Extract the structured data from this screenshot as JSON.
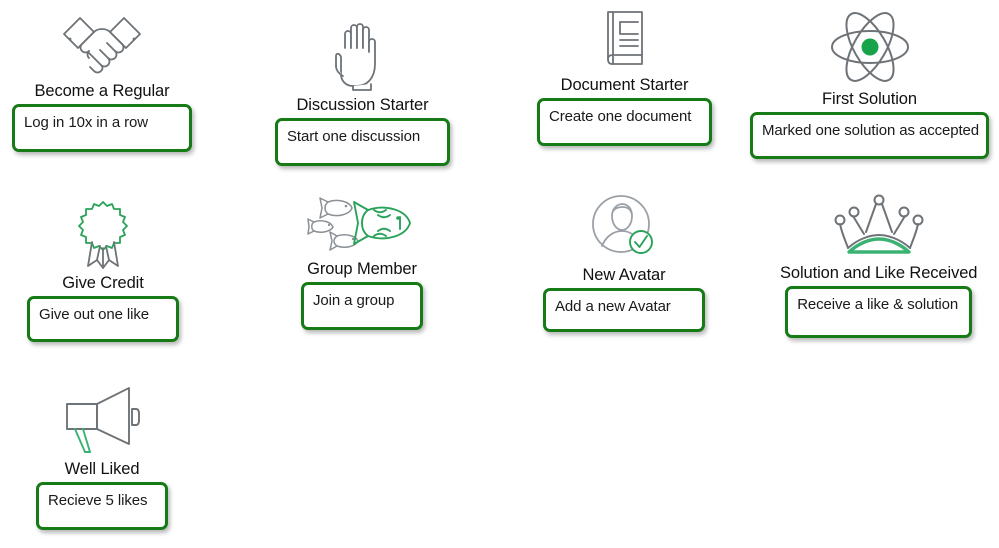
{
  "page": {
    "background": "#ffffff",
    "accent_green": "#167A16",
    "icon_stroke": "#6e7378",
    "icon_accent_green": "#21a05a"
  },
  "badges": [
    {
      "icon": "handshake-icon",
      "title": "Become a Regular",
      "description": "Log in 10x in a row"
    },
    {
      "icon": "raised-hand-icon",
      "title": "Discussion Starter",
      "description": "Start one discussion"
    },
    {
      "icon": "document-book-icon",
      "title": "Document Starter",
      "description": "Create one document"
    },
    {
      "icon": "atom-icon",
      "title": "First Solution",
      "description": "Marked one solution as accepted"
    },
    {
      "icon": "award-ribbon-icon",
      "title": "Give Credit",
      "description": "Give out one like"
    },
    {
      "icon": "fish-school-icon",
      "title": "Group Member",
      "description": "Join a group"
    },
    {
      "icon": "avatar-check-icon",
      "title": "New Avatar",
      "description": "Add a new Avatar"
    },
    {
      "icon": "crown-icon",
      "title": "Solution and Like Received",
      "description": "Receive a like & solution"
    },
    {
      "icon": "megaphone-icon",
      "title": "Well Liked",
      "description": "Recieve 5 likes"
    }
  ]
}
